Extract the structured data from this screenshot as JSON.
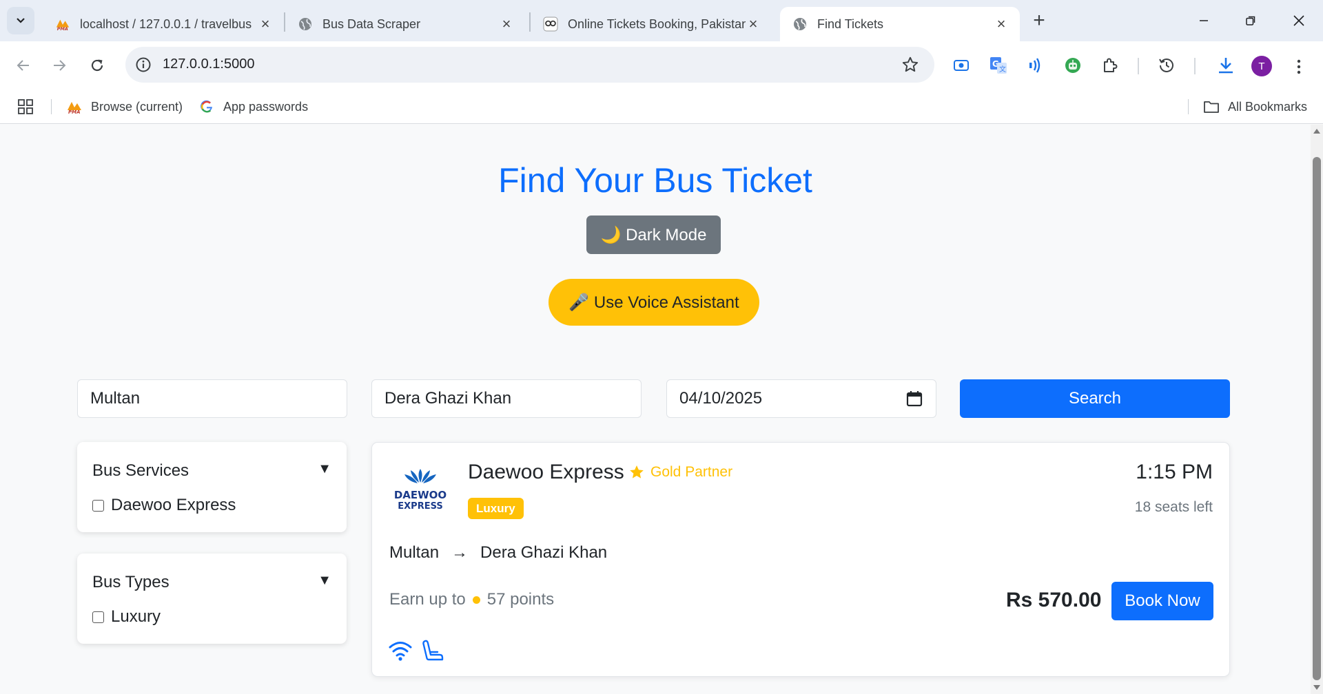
{
  "browser": {
    "tabs": [
      {
        "title": "localhost / 127.0.0.1 / travelbus",
        "favicon": "pma-icon"
      },
      {
        "title": "Bus Data Scraper",
        "favicon": "globe-icon"
      },
      {
        "title": "Online Tickets Booking, Pakistan",
        "favicon": "bookme-icon"
      },
      {
        "title": "Find Tickets",
        "favicon": "globe-icon",
        "active": true
      }
    ],
    "url": "127.0.0.1:5000",
    "profile_initial": "T",
    "profile_color": "#7b1fa2",
    "bookmarks": [
      {
        "label": "Browse (current)",
        "icon": "pma-icon"
      },
      {
        "label": "App passwords",
        "icon": "google-icon"
      }
    ],
    "all_bookmarks_label": "All Bookmarks"
  },
  "page": {
    "heading": "Find Your Bus Ticket",
    "dark_mode_label": "🌙 Dark Mode",
    "voice_label": "🎤 Use Voice Assistant",
    "search": {
      "from": "Multan",
      "to": "Dera Ghazi Khan",
      "date": "04/10/2025",
      "button_label": "Search"
    },
    "filters": [
      {
        "title": "Bus Services",
        "options": [
          "Daewoo Express"
        ]
      },
      {
        "title": "Bus Types",
        "options": [
          "Luxury"
        ]
      }
    ],
    "results": [
      {
        "operator": "Daewoo Express",
        "logo_text_top": "DAEWOO",
        "logo_text_bottom": "EXPRESS",
        "partner_label": "Gold Partner",
        "bus_type": "Luxury",
        "departure": "1:15 PM",
        "seats_left": "18 seats left",
        "origin": "Multan",
        "arrow": "→",
        "destination": "Dera Ghazi Khan",
        "points_prefix": "Earn up to",
        "points_value": "57 points",
        "price": "Rs 570.00",
        "book_label": "Book Now",
        "amenities": [
          "wifi-icon",
          "seat-icon"
        ]
      }
    ]
  },
  "colors": {
    "primary": "#0d6efd",
    "warning": "#ffc107",
    "secondary": "#6c757d",
    "page_bg": "#f8f9fa"
  }
}
